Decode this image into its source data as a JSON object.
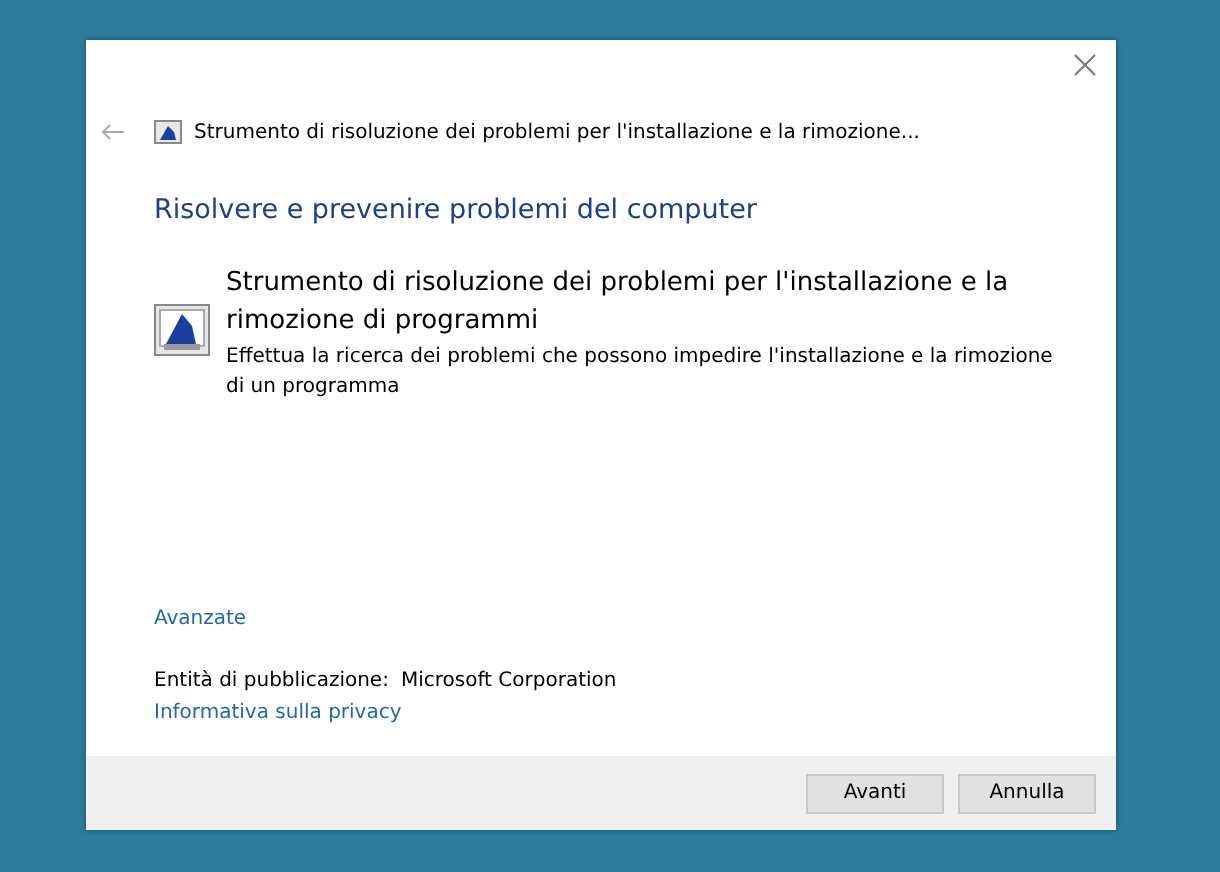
{
  "window": {
    "title": "Strumento di risoluzione dei problemi per l'installazione e la rimozione..."
  },
  "heading": "Risolvere e prevenire problemi del computer",
  "troubleshooter": {
    "title": "Strumento di risoluzione dei problemi per l'installazione e la rimozione di programmi",
    "description": "Effettua la ricerca dei problemi che possono impedire l'installazione e la rimozione di un programma"
  },
  "advanced_link": "Avanzate",
  "publisher": {
    "label": "Entità di pubblicazione:",
    "value": "Microsoft Corporation"
  },
  "privacy_link": "Informativa sulla privacy",
  "buttons": [
    "Avanti",
    "Annulla"
  ]
}
